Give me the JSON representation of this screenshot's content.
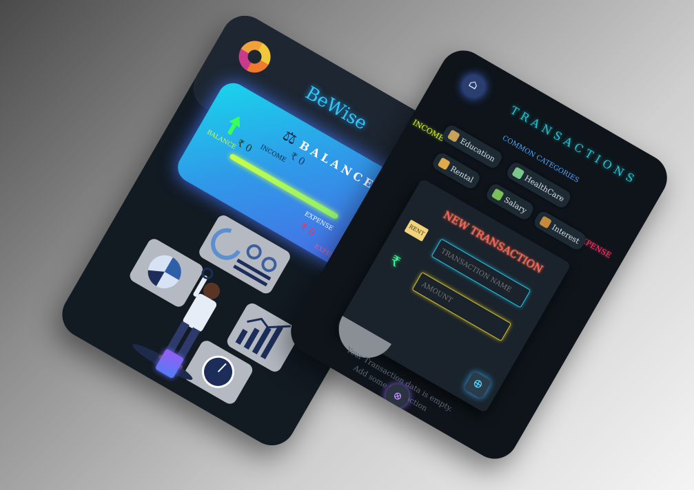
{
  "home": {
    "app_title": "BeWise",
    "balance_label": "BALANCE",
    "balance_amount": "₹ 0",
    "income_label": "INCOME",
    "income_amount": "₹ 0",
    "expense_label": "EXPENSE",
    "expense_amount": "₹ 0",
    "balance_side_label": "BALANCE",
    "expense_side_label": "EXPENSE",
    "progress_fraction": 1.0
  },
  "transactions": {
    "title": "TRANSACTIONS",
    "common_categories_label": "COMMON CATEGORIES",
    "income_side_label": "INCOME",
    "expense_side_label": "EXPENSE",
    "categories": [
      {
        "label": "Education",
        "icon": "education-icon",
        "color": "#c9a25a"
      },
      {
        "label": "HealthCare",
        "icon": "healthcare-icon",
        "color": "#7bc98a"
      },
      {
        "label": "Rental",
        "icon": "rental-icon",
        "color": "#e0a94a"
      },
      {
        "label": "Salary",
        "icon": "salary-icon",
        "color": "#7bbf5a"
      },
      {
        "label": "Interest",
        "icon": "interest-icon",
        "color": "#c78a3a"
      }
    ],
    "modal": {
      "title": "NEW TRANSACTION",
      "rent_badge": "RENT",
      "name_placeholder": "TRANSACTION NAME",
      "amount_placeholder": "AMOUNT",
      "rupee_symbol": "₹"
    },
    "empty_message_line1": "Your Transaction data is empty.",
    "empty_message_line2": "Add some transaction"
  },
  "colors": {
    "background": "#121a22",
    "accent_blue": "#33c7f5",
    "income_green": "#38ff5a",
    "expense_red": "#ff2a55",
    "teal": "#27c5d3"
  }
}
